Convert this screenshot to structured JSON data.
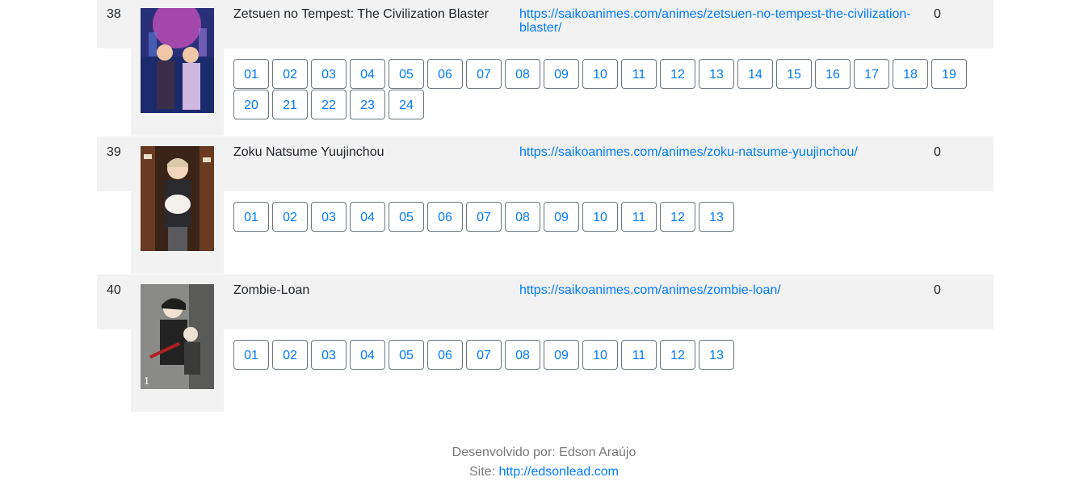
{
  "rows": [
    {
      "number": "38",
      "title": "Zetsuen no Tempest: The Civilization Blaster",
      "url": "https://saikoanimes.com/animes/zetsuen-no-tempest-the-civilization-blaster/",
      "count": "0",
      "poster_icon": "anime-poster-zetsuen-no-tempest",
      "episodes": [
        "01",
        "02",
        "03",
        "04",
        "05",
        "06",
        "07",
        "08",
        "09",
        "10",
        "11",
        "12",
        "13",
        "14",
        "15",
        "16",
        "17",
        "18",
        "19",
        "20",
        "21",
        "22",
        "23",
        "24"
      ]
    },
    {
      "number": "39",
      "title": "Zoku Natsume Yuujinchou",
      "url": "https://saikoanimes.com/animes/zoku-natsume-yuujinchou/",
      "count": "0",
      "poster_icon": "anime-poster-zoku-natsume-yuujinchou",
      "episodes": [
        "01",
        "02",
        "03",
        "04",
        "05",
        "06",
        "07",
        "08",
        "09",
        "10",
        "11",
        "12",
        "13"
      ]
    },
    {
      "number": "40",
      "title": "Zombie-Loan",
      "url": "https://saikoanimes.com/animes/zombie-loan/",
      "count": "0",
      "poster_icon": "anime-poster-zombie-loan",
      "episodes": [
        "01",
        "02",
        "03",
        "04",
        "05",
        "06",
        "07",
        "08",
        "09",
        "10",
        "11",
        "12",
        "13"
      ]
    }
  ],
  "footer": {
    "developer": "Desenvolvido por: Edson Araújo",
    "site_label": "Site:",
    "site_url": "http://edsonlead.com"
  },
  "colors": {
    "link": "#007bff",
    "row_shade": "#f2f2f2",
    "button_border": "#6c757d",
    "footer_text": "#777777"
  }
}
